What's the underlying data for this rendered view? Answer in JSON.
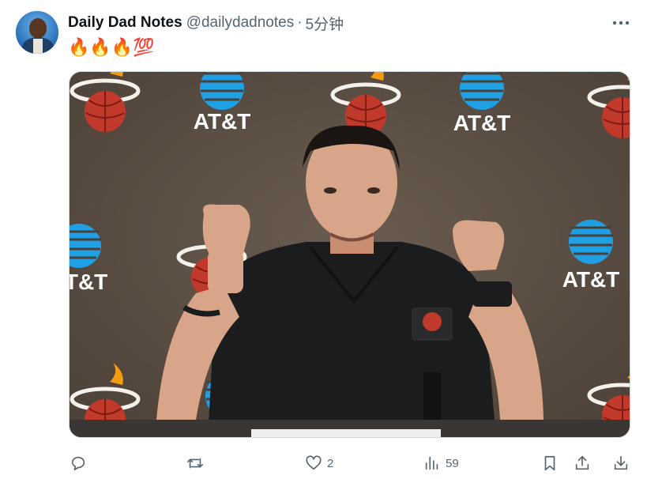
{
  "tweet": {
    "author": {
      "display_name": "Daily Dad Notes",
      "handle": "@dailydadnotes",
      "separator": "·",
      "time_ago": "5分钟"
    },
    "text": "🔥🔥🔥💯",
    "media": {
      "sponsor_text": "AT&T",
      "palette": {
        "backdrop": "#5a4d42",
        "flame": "#c0392b",
        "att_blue": "#1fa0e4",
        "shirt": "#1b1c1e",
        "skin": "#d8a588"
      }
    },
    "actions": {
      "reply": {
        "icon": "reply-icon",
        "count": ""
      },
      "retweet": {
        "icon": "retweet-icon",
        "count": ""
      },
      "like": {
        "icon": "heart-icon",
        "count": "2"
      },
      "views": {
        "icon": "views-icon",
        "count": "59"
      },
      "bookmark": {
        "icon": "bookmark-icon"
      },
      "share": {
        "icon": "share-icon"
      },
      "download": {
        "icon": "download-icon"
      }
    }
  }
}
